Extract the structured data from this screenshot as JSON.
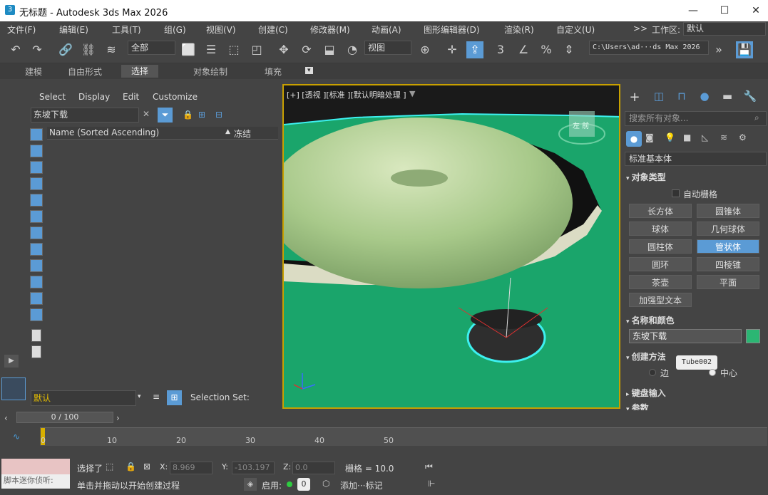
{
  "window": {
    "title": "无标题 - Autodesk 3ds Max 2026",
    "minimize": "—",
    "maximize": "☐",
    "close": "✕"
  },
  "menu": [
    "文件(F)",
    "编辑(E)",
    "工具(T)",
    "组(G)",
    "视图(V)",
    "创建(C)",
    "修改器(M)",
    "动画(A)",
    "图形编辑器(D)",
    "渲染(R)",
    "自定义(U)"
  ],
  "workspace": {
    "label": "工作区:",
    "value": "默认",
    "more": ">>"
  },
  "toolbar": {
    "selection_filter": "全部",
    "ref_coord": "视图",
    "path": "C:\\Users\\ad···ds Max 2026"
  },
  "ribbon": {
    "tabs": [
      "建模",
      "自由形式",
      "选择",
      "对象绘制",
      "填充"
    ],
    "active": 2
  },
  "scene_explorer": {
    "menu": [
      "Select",
      "Display",
      "Edit",
      "Customize"
    ],
    "search_value": "东坡下载",
    "col_name": "Name (Sorted Ascending)",
    "col_freeze": "冻结",
    "layer_value": "默认",
    "selection_set": "Selection Set:"
  },
  "viewport": {
    "label": "[+] [透视 ][标准 ][默认明暗处理 ]",
    "viewcube": "左  前"
  },
  "command_panel": {
    "search_placeholder": "搜索所有对象...",
    "category": "标准基本体",
    "object_type": "对象类型",
    "autogrid": "自动栅格",
    "buttons": [
      "长方体",
      "圆锥体",
      "球体",
      "几何球体",
      "圆柱体",
      "管状体",
      "圆环",
      "四棱锥",
      "茶壶",
      "平面",
      "加强型文本"
    ],
    "active_button": "管状体",
    "name_color": "名称和颜色",
    "name_value": "东坡下载",
    "object_color": "#2bb673",
    "creation_method": "创建方法",
    "tooltip": "Tube002",
    "radio_edge": "边",
    "radio_center": "中心",
    "keyboard_entry": "键盘输入",
    "params": "参数"
  },
  "timeline": {
    "frame": "0 / 100",
    "ticks": [
      "0",
      "10",
      "20",
      "30",
      "40",
      "50"
    ]
  },
  "status": {
    "script_input": "脚本迷你侦听:",
    "selection": "选择了",
    "x_label": "X:",
    "x_value": "8.969",
    "y_label": "Y:",
    "y_value": "-103.197",
    "z_label": "Z:",
    "z_value": "0.0",
    "grid": "栅格 = 10.0",
    "prompt": "单击并拖动以开始创建过程",
    "enable": "启用:",
    "add_tag": "添加···标记"
  }
}
